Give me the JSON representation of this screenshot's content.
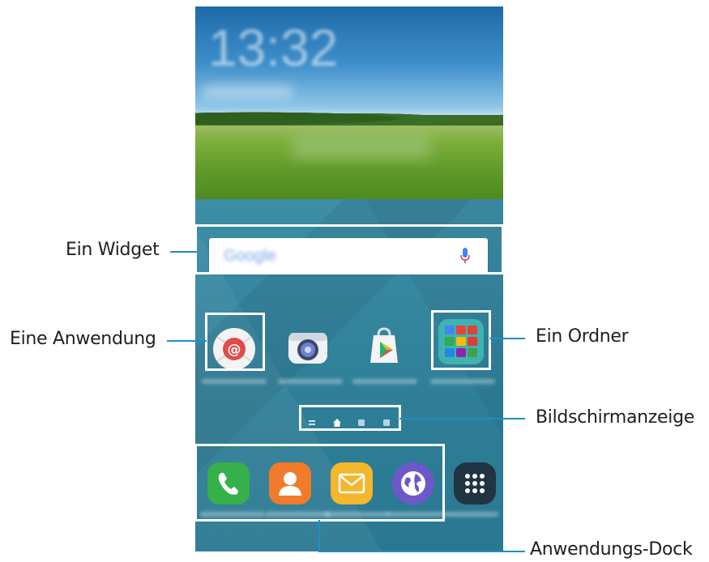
{
  "callouts": {
    "widget": "Ein Widget",
    "application": "Eine Anwendung",
    "folder": "Ein Ordner",
    "page_indicator": "Bildschirmanzeige",
    "dock": "Anwendungs-Dock"
  },
  "clock_time": "13:32",
  "search_logo": "Google",
  "colors": {
    "callout_line": "#1c8fc3",
    "highlight_border": "#ffffff",
    "phone_wallpaper": "#3d8ea6"
  },
  "home_apps": [
    {
      "icon": "email-icon"
    },
    {
      "icon": "camera-icon"
    },
    {
      "icon": "play-store-icon"
    },
    {
      "icon": "google-folder-icon"
    }
  ],
  "page_indicators": [
    "menu-indicator-icon",
    "home-indicator-icon",
    "page-dot",
    "page-dot"
  ],
  "dock_apps": [
    {
      "icon": "phone-icon"
    },
    {
      "icon": "contacts-icon"
    },
    {
      "icon": "messages-icon"
    },
    {
      "icon": "internet-icon"
    },
    {
      "icon": "apps-grid-icon"
    }
  ]
}
